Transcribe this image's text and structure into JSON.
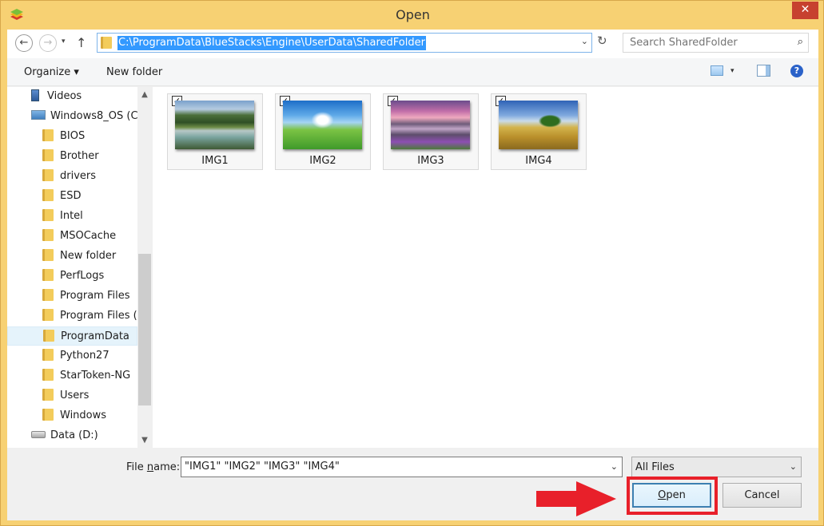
{
  "window": {
    "title": "Open",
    "close_glyph": "✕",
    "app_icon": "bluestacks-icon"
  },
  "address_bar": {
    "back_glyph": "←",
    "forward_glyph": "→",
    "up_glyph": "↑",
    "path": "C:\\ProgramData\\BlueStacks\\Engine\\UserData\\SharedFolder",
    "refresh_glyph": "↻"
  },
  "search": {
    "placeholder": "Search SharedFolder",
    "icon_glyph": "⌕"
  },
  "toolbar": {
    "organize_label": "Organize ▾",
    "new_folder_label": "New folder",
    "help_glyph": "?"
  },
  "nav_tree": {
    "items": [
      {
        "label": "Videos",
        "icon": "video-icon"
      },
      {
        "label": "Windows8_OS (C",
        "icon": "drive-icon"
      },
      {
        "label": "BIOS",
        "icon": "folder-icon"
      },
      {
        "label": "Brother",
        "icon": "folder-icon"
      },
      {
        "label": "drivers",
        "icon": "folder-icon"
      },
      {
        "label": "ESD",
        "icon": "folder-icon"
      },
      {
        "label": "Intel",
        "icon": "folder-icon"
      },
      {
        "label": "MSOCache",
        "icon": "folder-icon"
      },
      {
        "label": "New folder",
        "icon": "folder-icon"
      },
      {
        "label": "PerfLogs",
        "icon": "folder-icon"
      },
      {
        "label": "Program Files",
        "icon": "folder-icon"
      },
      {
        "label": "Program Files (x",
        "icon": "folder-icon"
      },
      {
        "label": "ProgramData",
        "icon": "folder-icon",
        "selected": true
      },
      {
        "label": "Python27",
        "icon": "folder-icon"
      },
      {
        "label": "StarToken-NG",
        "icon": "folder-icon"
      },
      {
        "label": "Users",
        "icon": "folder-icon"
      },
      {
        "label": "Windows",
        "icon": "folder-icon"
      },
      {
        "label": "Data (D:)",
        "icon": "hdd-icon"
      }
    ]
  },
  "files": [
    {
      "name": "IMG1",
      "checked": true
    },
    {
      "name": "IMG2",
      "checked": true
    },
    {
      "name": "IMG3",
      "checked": true
    },
    {
      "name": "IMG4",
      "checked": true
    }
  ],
  "bottom": {
    "file_name_label_pre": "File ",
    "file_name_label_u": "n",
    "file_name_label_post": "ame:",
    "file_name_value": "\"IMG1\" \"IMG2\" \"IMG3\" \"IMG4\"",
    "filter_value": "All Files",
    "open_u": "O",
    "open_rest": "pen",
    "cancel_label": "Cancel",
    "highlight_color": "#e8202a"
  }
}
